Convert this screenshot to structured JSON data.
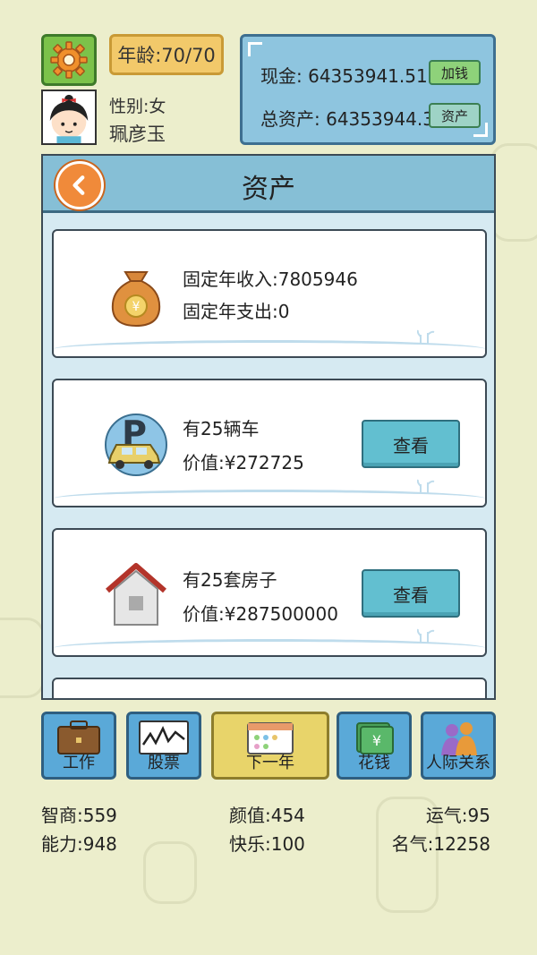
{
  "player": {
    "age": "年龄:70/70",
    "gender": "性别:女",
    "name": "珮彦玉"
  },
  "money": {
    "cash": "现金: 64353941.516",
    "add_money_label": "加钱",
    "total_assets": "总资产: 64353944.3",
    "assets_label": "资产"
  },
  "panel": {
    "title": "资产",
    "income_card": {
      "line1": "固定年收入:7805946",
      "line2": "固定年支出:0"
    },
    "car_card": {
      "line1": "有25辆车",
      "line2": "价值:¥272725",
      "button": "查看"
    },
    "house_card": {
      "line1": "有25套房子",
      "line2": "价值:¥287500000",
      "button": "查看"
    }
  },
  "nav": [
    {
      "label": "工作",
      "icon": "briefcase-icon"
    },
    {
      "label": "股票",
      "icon": "stock-chart-icon"
    },
    {
      "label": "下一年",
      "icon": "calendar-icon"
    },
    {
      "label": "花钱",
      "icon": "cash-icon"
    },
    {
      "label": "人际关系",
      "icon": "people-icon"
    }
  ],
  "stats": {
    "iq": "智商:559",
    "looks": "颜值:454",
    "luck": "运气:95",
    "ability": "能力:948",
    "happiness": "快乐:100",
    "fame": "名气:12258"
  },
  "colors": {
    "background": "#eceecc",
    "panel_blue": "#86bfd6",
    "button_teal": "#62bfd0",
    "nav_blue": "#5aa9d8",
    "nav_yellow": "#e8d46a",
    "settings_green": "#7cc24a",
    "age_orange": "#f2c96a"
  }
}
